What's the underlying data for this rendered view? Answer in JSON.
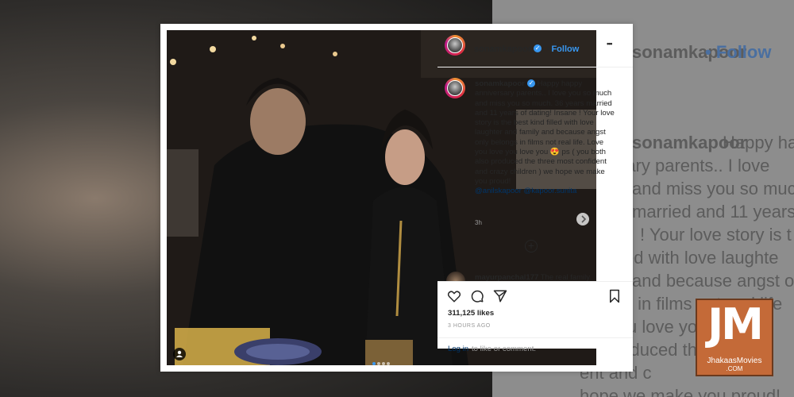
{
  "post": {
    "username": "sonamkapoor",
    "separator": "•",
    "follow_label": "Follow",
    "more_label": "•••",
    "caption_text": "Happy happy anniversary parents.. I love you so much and miss you so much. 36 years married and 11 years of dating! Insane ! Your love story is the best kind filled with love laughter and family and because angst only belongs in films not real life. Love you love you love you 😍 ps ( you both also produced the three most confident and crazy children ) we hope we make you proud!",
    "mentions": [
      "@anilskapoor",
      "@kapoor.sunita"
    ],
    "caption_time": "3h",
    "load_more_icon": "plus-circle-icon",
    "comment_preview": {
      "username": "mayurpanchal177",
      "text": "The real family"
    },
    "likes": "311,125 likes",
    "time_ago": "3 HOURS AGO",
    "login_link": "Log in",
    "login_rest": "to like or comment."
  },
  "icons": {
    "like": "heart-icon",
    "comment": "comment-icon",
    "share": "share-icon",
    "save": "bookmark-icon",
    "tagged": "user-tag-icon",
    "next": "chevron-right-icon",
    "verified": "verified-badge-icon"
  },
  "colors": {
    "link_blue": "#3897f0",
    "mention_blue": "#003569",
    "logo_orange": "#c46a38"
  },
  "background": {
    "username": "sonamkapoor",
    "follow_label": "• Follow",
    "lines": [
      "Happy ha",
      "rsary parents.. I love",
      "and miss you so muc",
      "married and 11 years",
      "! Your love story is t",
      "ed with love laughte",
      "and because angst o",
      "s in films not real life",
      "u love you 😍 ( y",
      "roduced th",
      "ent and c",
      "hope we make you proud!"
    ]
  },
  "watermark": {
    "logo_text": "JM",
    "site_name": "JhakaasMovies",
    "domain": ".COM"
  }
}
